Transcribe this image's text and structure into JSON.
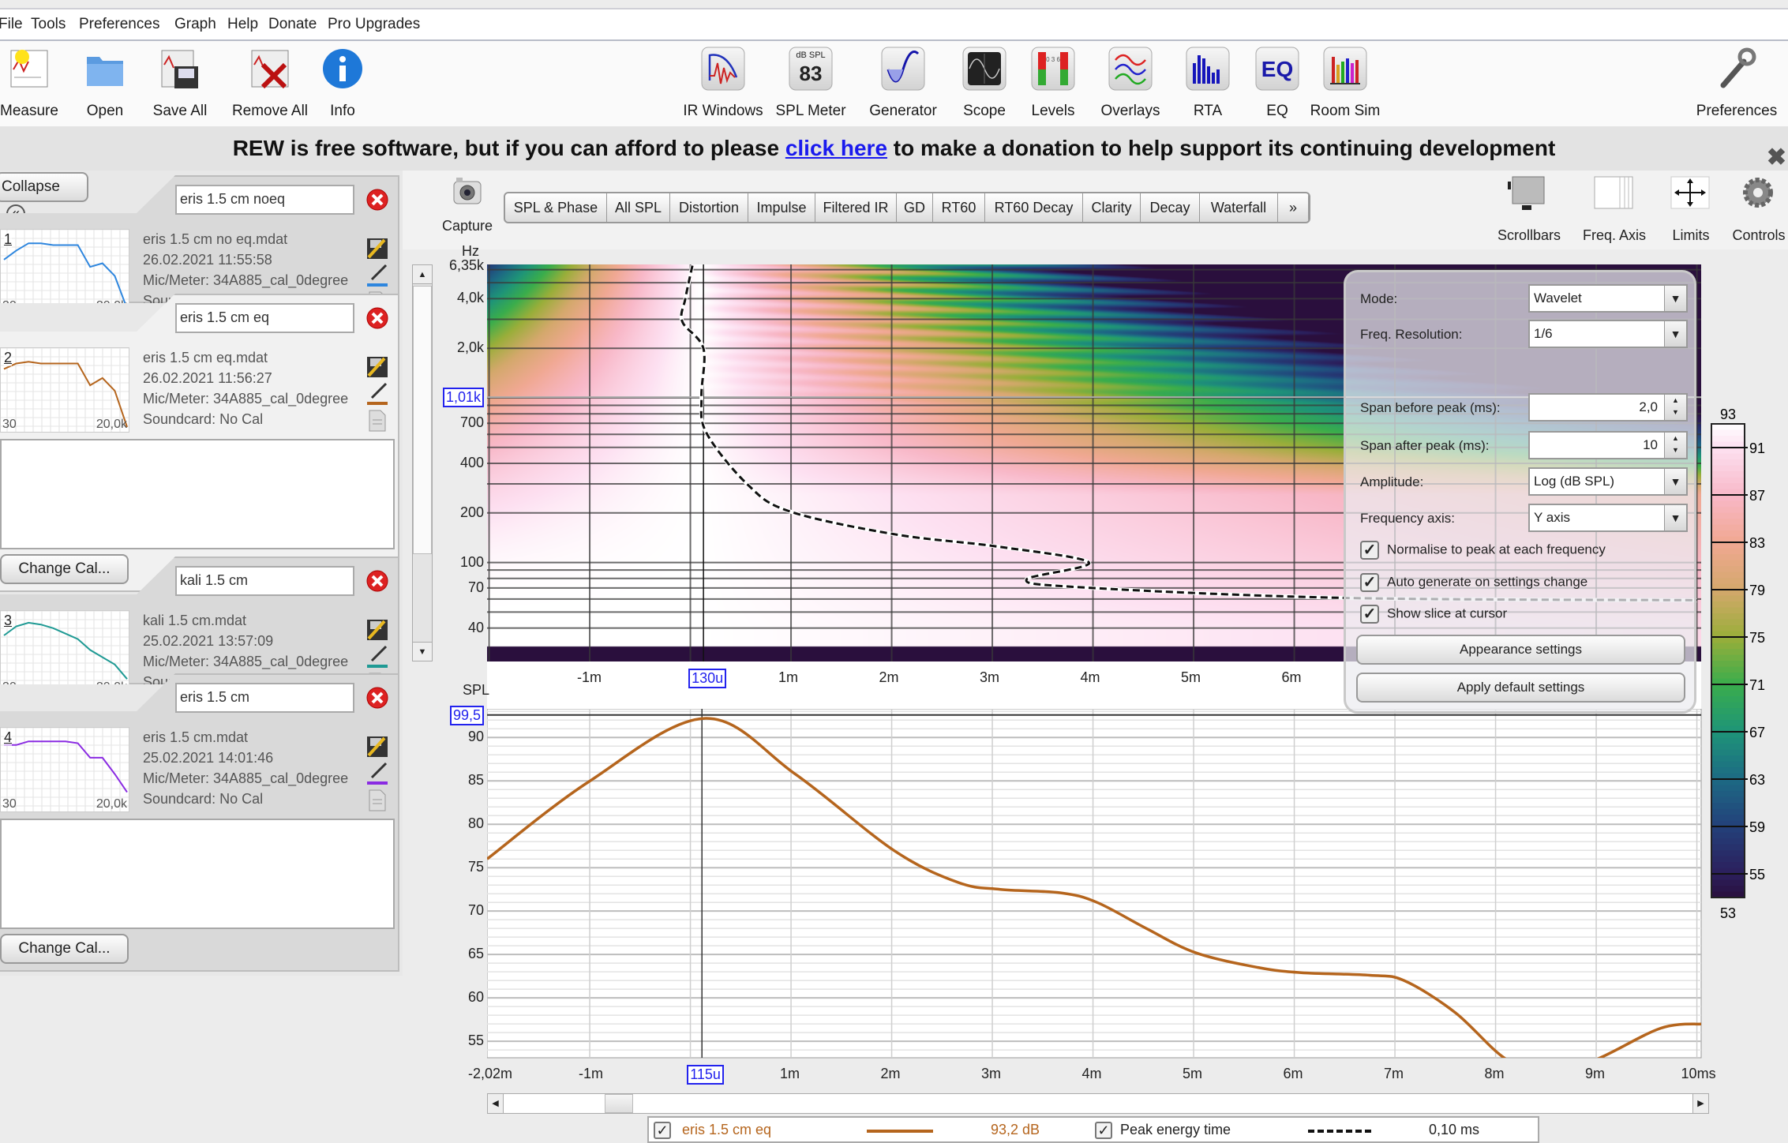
{
  "menu": [
    "File",
    "Tools",
    "Preferences",
    "Graph",
    "Help",
    "Donate",
    "Pro Upgrades"
  ],
  "toolbar": {
    "left": [
      {
        "label": "Measure",
        "icon": "measure-icon"
      },
      {
        "label": "Open",
        "icon": "folder-icon"
      },
      {
        "label": "Save All",
        "icon": "save-all-icon"
      },
      {
        "label": "Remove All",
        "icon": "remove-all-icon"
      },
      {
        "label": "Info",
        "icon": "info-icon"
      }
    ],
    "center": [
      {
        "label": "IR Windows",
        "icon": "ir-windows-icon"
      },
      {
        "label": "SPL Meter",
        "icon": "spl-meter-icon"
      },
      {
        "label": "Generator",
        "icon": "generator-icon"
      },
      {
        "label": "Scope",
        "icon": "scope-icon"
      },
      {
        "label": "Levels",
        "icon": "levels-icon"
      },
      {
        "label": "Overlays",
        "icon": "overlays-icon"
      },
      {
        "label": "RTA",
        "icon": "rta-icon"
      },
      {
        "label": "EQ",
        "icon": "eq-icon"
      },
      {
        "label": "Room Sim",
        "icon": "room-sim-icon"
      }
    ],
    "spl_meter_unit": "dB SPL",
    "spl_meter_value": "83",
    "eq_icon_text": "EQ",
    "preferences": {
      "label": "Preferences",
      "icon": "wrench-icon"
    }
  },
  "banner": {
    "before": "REW is free software, but if you can afford to please ",
    "link": "click here",
    "after": " to make a donation to help support its continuing development",
    "close": "✖"
  },
  "sidebar": {
    "collapse_label": "Collapse",
    "collapse_icon": "«",
    "change_cal_label": "Change Cal...",
    "thumb_min": "30",
    "thumb_max": "20,0k",
    "measurements": [
      {
        "index": "1",
        "name": "eris 1.5 cm noeq",
        "file": "eris 1.5 cm no eq.mdat",
        "date": "26.02.2021 11:55:58",
        "mic": "Mic/Meter: 34A885_cal_0degree",
        "soundcard": "Soundcard: No Cal",
        "color": "#2e86de",
        "selected": false,
        "has_notes": false,
        "response_db": [
          -13,
          -8,
          -4,
          -4,
          -5,
          -5,
          -5,
          -17,
          -15,
          -22,
          -40
        ]
      },
      {
        "index": "2",
        "name": "eris 1.5 cm eq",
        "file": "eris 1.5 cm eq.mdat",
        "date": "26.02.2021 11:56:27",
        "mic": "Mic/Meter: 34A885_cal_0degree",
        "soundcard": "Soundcard: No Cal",
        "color": "#b5651d",
        "selected": true,
        "has_notes": true,
        "response_db": [
          -8,
          -5,
          -4,
          -5,
          -5,
          -5,
          -5,
          -17,
          -13,
          -20,
          -40
        ]
      },
      {
        "index": "3",
        "name": "kali 1.5 cm",
        "file": "kali 1.5 cm.mdat",
        "date": "25.02.2021 13:57:09",
        "mic": "Mic/Meter: 34A885_cal_0degree",
        "soundcard": "Soundcard: No Cal",
        "color": "#1f9a94",
        "selected": false,
        "has_notes": false,
        "response_db": [
          -10,
          -5,
          -3,
          -4,
          -6,
          -9,
          -12,
          -18,
          -22,
          -26,
          -34
        ]
      },
      {
        "index": "4",
        "name": "eris 1.5 cm",
        "file": "eris 1.5 cm.mdat",
        "date": "25.02.2021 14:01:46",
        "mic": "Mic/Meter: 34A885_cal_0degree",
        "soundcard": "Soundcard: No Cal",
        "color": "#8a2be2",
        "selected": false,
        "has_notes": true,
        "response_db": [
          -6,
          -6,
          -4,
          -4,
          -4,
          -4,
          -5,
          -13,
          -13,
          -22,
          -32
        ]
      }
    ]
  },
  "graph": {
    "capture_label": "Capture",
    "tabs": [
      "SPL & Phase",
      "All SPL",
      "Distortion",
      "Impulse",
      "Filtered IR",
      "GD",
      "RT60",
      "RT60 Decay",
      "Clarity",
      "Decay",
      "Waterfall",
      "»"
    ],
    "tools": [
      {
        "label": "Scrollbars",
        "icon": "scrollbars-icon"
      },
      {
        "label": "Freq. Axis",
        "icon": "freq-axis-icon"
      },
      {
        "label": "Limits",
        "icon": "limits-icon"
      },
      {
        "label": "Controls",
        "icon": "gear-icon"
      }
    ]
  },
  "controls": {
    "mode_label": "Mode:",
    "mode_value": "Wavelet",
    "freq_res_label": "Freq. Resolution:",
    "freq_res_value": "1/6",
    "span_before_label": "Span before peak (ms):",
    "span_before_value": "2,0",
    "span_after_label": "Span after peak (ms):",
    "span_after_value": "10",
    "amplitude_label": "Amplitude:",
    "amplitude_value": "Log (dB SPL)",
    "freq_axis_label": "Frequency axis:",
    "freq_axis_value": "Y axis",
    "checkboxes": [
      {
        "label": "Normalise to peak at each frequency",
        "checked": true
      },
      {
        "label": "Auto generate on settings change",
        "checked": true
      },
      {
        "label": "Show slice at cursor",
        "checked": true
      }
    ],
    "appearance_label": "Appearance settings",
    "defaults_label": "Apply default settings"
  },
  "chart_data": [
    {
      "type": "heatmap",
      "ylabel": "Hz",
      "x_ticks": [
        "-1m",
        "1m",
        "2m",
        "3m",
        "4m",
        "5m",
        "6m"
      ],
      "x_tick_values_ms": [
        -1,
        1,
        2,
        3,
        4,
        5,
        6
      ],
      "x_cursor_label": "130u",
      "x_cursor_ms": 0.13,
      "y_ticks": [
        "6,35k",
        "4,0k",
        "2,0k",
        "700",
        "400",
        "200",
        "100",
        "70",
        "40"
      ],
      "y_tick_values_hz": [
        6350,
        4000,
        2000,
        700,
        400,
        200,
        100,
        70,
        40
      ],
      "y_cursor_label": "1,01k",
      "y_cursor_hz": 1010,
      "y_scale": "log",
      "xlim_ms": [
        -2.02,
        10
      ],
      "ylim_hz": [
        25,
        6350
      ],
      "colorbar": {
        "min": 53,
        "max": 93,
        "ticks": [
          93,
          91,
          87,
          83,
          79,
          75,
          71,
          67,
          63,
          59,
          55,
          53
        ],
        "colors": {
          "53": "#2a0f3d",
          "55": "#2b1f5c",
          "59": "#23407a",
          "63": "#1d6a84",
          "67": "#1e9478",
          "71": "#3aad4c",
          "75": "#9aae3a",
          "79": "#d4a86c",
          "83": "#f0a892",
          "87": "#f8b8c8",
          "91": "#fde0f1",
          "93": "#ffffff"
        }
      },
      "peak_energy_time": {
        "name": "Peak energy time",
        "points_ms_hz": [
          [
            0.02,
            6350
          ],
          [
            -0.05,
            4000
          ],
          [
            -0.08,
            2900
          ],
          [
            0.13,
            1990
          ],
          [
            0.11,
            1013
          ],
          [
            0.16,
            611
          ],
          [
            0.57,
            297
          ],
          [
            0.99,
            204
          ],
          [
            2.04,
            148
          ],
          [
            3.05,
            125
          ],
          [
            3.96,
            100
          ],
          [
            3.34,
            79
          ],
          [
            3.88,
            70.7
          ],
          [
            6.47,
            61
          ],
          [
            10,
            59
          ]
        ]
      }
    },
    {
      "type": "line",
      "ylabel": "SPL",
      "x_ticks": [
        "-2,02m",
        "-1m",
        "1m",
        "2m",
        "3m",
        "4m",
        "5m",
        "6m",
        "7m",
        "8m",
        "9m",
        "10ms"
      ],
      "x_tick_values_ms": [
        -2.02,
        -1,
        1,
        2,
        3,
        4,
        5,
        6,
        7,
        8,
        9,
        10
      ],
      "x_cursor_label": "115u",
      "x_cursor_ms": 0.115,
      "y_cursor_label": "99,5",
      "y_ticks": [
        90,
        85,
        80,
        75,
        70,
        65,
        60,
        55
      ],
      "xlim_ms": [
        -2.02,
        10.05
      ],
      "ylim_db": [
        53.1,
        93.3
      ],
      "grid": true,
      "series": [
        {
          "name": "eris 1.5 cm eq",
          "color": "#b5651d",
          "x_ms": [
            -2.02,
            -1.01,
            0.14,
            1.04,
            2.02,
            2.66,
            3.08,
            3.68,
            4.04,
            4.53,
            5.02,
            5.64,
            6.07,
            6.75,
            7.09,
            7.6,
            8.11,
            8.55,
            9.0,
            9.64,
            10.05
          ],
          "y_db": [
            76.0,
            84.9,
            92.2,
            85.8,
            77.0,
            73.3,
            72.5,
            72.1,
            71.0,
            68.0,
            65.2,
            63.5,
            62.9,
            62.6,
            62.0,
            58.3,
            52.9,
            51.5,
            52.9,
            56.5,
            57.0
          ]
        }
      ]
    }
  ],
  "legend": {
    "series_label": "eris 1.5 cm eq",
    "series_value": "93,2 dB",
    "series_color": "#b5651d",
    "peak_label": "Peak energy time",
    "peak_value": "0,10 ms",
    "checked": "✓"
  }
}
